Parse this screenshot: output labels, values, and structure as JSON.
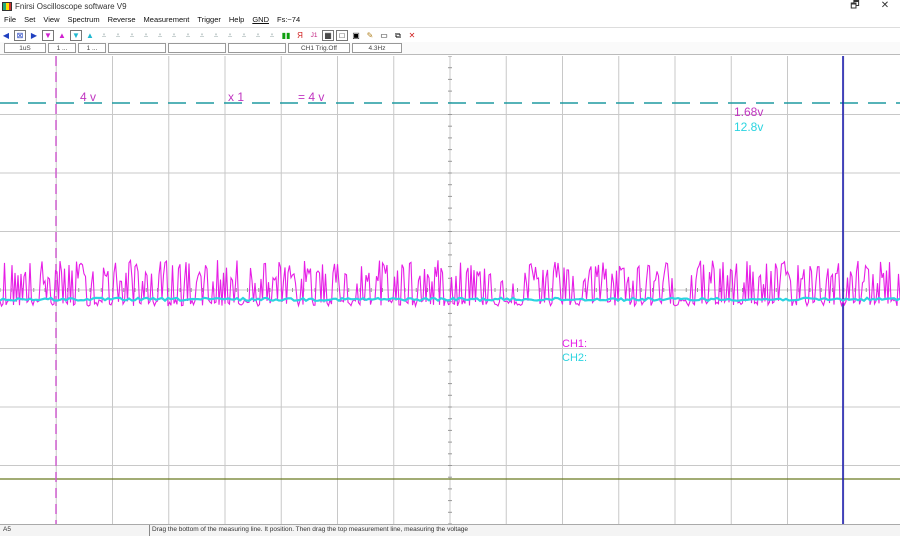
{
  "window": {
    "title": "Fnirsi Oscilloscope software V9",
    "minimize_glyph": "🗗",
    "close_glyph": "✕"
  },
  "menu": {
    "items": [
      "File",
      "Set",
      "View",
      "Spectrum",
      "Reverse",
      "Measurement",
      "Trigger",
      "Help",
      "GND",
      "Fs:~74"
    ]
  },
  "toolbar": {
    "icons": [
      "left-arrow",
      "zoom-box",
      "right-arrow",
      "ch1-up",
      "ch1-down",
      "ch2-up",
      "ch2-down",
      "level-1",
      "level-2",
      "level-3",
      "level-4",
      "level-5",
      "level-6",
      "level-7",
      "level-8",
      "level-9",
      "level-10",
      "level-11",
      "level-12",
      "level-13",
      "run",
      "stop-marker",
      "cursor",
      "measure",
      "square",
      "save",
      "paint",
      "window",
      "copy",
      "close"
    ],
    "stop_marker_label": "Я",
    "cursor_label": "J1",
    "close_label": "✕"
  },
  "status": {
    "fields": [
      "1uS",
      "1 ...",
      "1 ...",
      "",
      "",
      "",
      "CH1 Trig.Off",
      "4.3Hz"
    ]
  },
  "scope": {
    "ch1_scale": "4 v",
    "probe": "x 1",
    "ch1_total": "= 4 v",
    "readout_1": "1.68v",
    "readout_2": "12.8v",
    "ch1_label": "CH1:",
    "ch2_label": "CH2:",
    "colors": {
      "ch1": "#e61ee6",
      "ch2": "#2bd4e0",
      "teal_dash": "#1e9aa0",
      "violet_cursor": "#d060d0",
      "blue_cursor": "#2020b0",
      "grid": "#c8c8c8",
      "ground": "#6b7a20",
      "annotation": "#c035c0"
    },
    "waveform": {
      "ch1_center_v": -0.5,
      "ch1_peak_v": 2.05,
      "ch1_trough_v": -1.1,
      "ch2_level_v": -0.5,
      "volts_per_div": 4,
      "divisions_vertical": 8
    }
  },
  "footer": {
    "left": "A5",
    "hint": "Drag the bottom of the measuring line. It position. Then drag the top measurement line, measuring the voltage"
  }
}
